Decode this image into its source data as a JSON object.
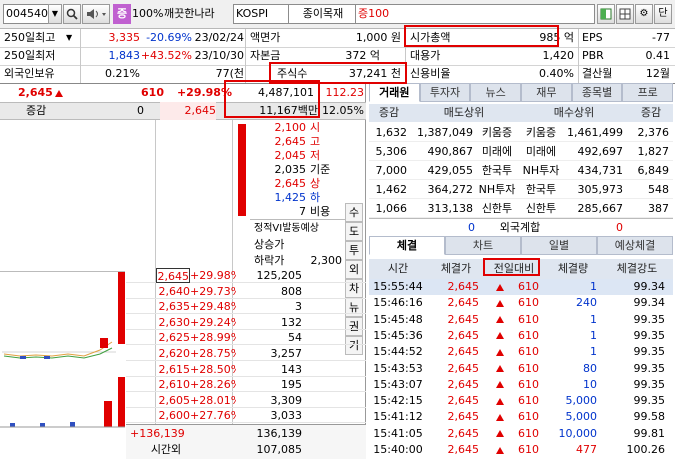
{
  "toolbar": {
    "code": "004540",
    "percent": "100%",
    "stock_name": "깨끗한나라",
    "market": "KOSPI",
    "sector": "종이목재",
    "margin": "증100",
    "tag": "증",
    "right_label": "단"
  },
  "info_rows": [
    {
      "label": "250일최고",
      "v1": "3,335",
      "v2": "-20.69%",
      "v3": "23/02/24",
      "l2": "액면가",
      "v4": "1,000 원",
      "l3": "시가총액",
      "v5": "985 억",
      "l4": "EPS",
      "v6": "-77"
    },
    {
      "label": "250일최저",
      "v1": "1,843",
      "v2": "+43.52%",
      "v3": "23/10/30",
      "l2": "자본금",
      "v4": "372 억",
      "l3": "대용가",
      "v5": "1,420",
      "l4": "PBR",
      "v6": "0.41"
    },
    {
      "label": "외국인보유",
      "v1": "0.21%",
      "v2": "",
      "v3": "77(천",
      "l2": "주식수",
      "v4": "37,241 천",
      "l3": "신용비율",
      "v5": "0.40%",
      "l4": "결산월",
      "v6": "12월"
    }
  ],
  "price_row": {
    "price": "2,645",
    "change": "610",
    "rate": "+29.98%",
    "volume": "4,487,101",
    "prev": "112.23"
  },
  "amount_row": {
    "label": "증감",
    "zero": "0",
    "price": "2,645",
    "amount": "11,167백만",
    "ratio": "12.05%"
  },
  "price_info": [
    {
      "value": "2,100",
      "label": "시"
    },
    {
      "value": "2,645",
      "label": "고"
    },
    {
      "value": "2,045",
      "label": "저"
    },
    {
      "value": "2,035",
      "label": "기준"
    },
    {
      "value": "2,645",
      "label": "상"
    },
    {
      "value": "1,425",
      "label": "하"
    },
    {
      "value": "7",
      "label": "비용"
    }
  ],
  "vi": {
    "title": "정적VI발동예상",
    "up_label": "상승가",
    "down_label": "하락가",
    "down_value": "2,300"
  },
  "side_buttons": [
    "수",
    "도",
    "투",
    "외",
    "차",
    "뉴",
    "권",
    "기"
  ],
  "asks": [],
  "bids": [
    {
      "price": "2,645",
      "rate": "+29.98%",
      "qty": "125,205"
    },
    {
      "price": "2,640",
      "rate": "+29.73%",
      "qty": "808"
    },
    {
      "price": "2,635",
      "rate": "+29.48%",
      "qty": "3"
    },
    {
      "price": "2,630",
      "rate": "+29.24%",
      "qty": "132"
    },
    {
      "price": "2,625",
      "rate": "+28.99%",
      "qty": "54"
    },
    {
      "price": "2,620",
      "rate": "+28.75%",
      "qty": "3,257"
    },
    {
      "price": "2,615",
      "rate": "+28.50%",
      "qty": "143"
    },
    {
      "price": "2,610",
      "rate": "+28.26%",
      "qty": "195"
    },
    {
      "price": "2,605",
      "rate": "+28.01%",
      "qty": "3,309"
    },
    {
      "price": "2,600",
      "rate": "+27.76%",
      "qty": "3,033"
    }
  ],
  "totals": {
    "diff": "+136,139",
    "bid_total": "136,139",
    "after_label": "시간외",
    "after_value": "107,085"
  },
  "broker_tabs": [
    "거래원",
    "투자자",
    "뉴스",
    "재무",
    "종목별",
    "프로"
  ],
  "broker_header": {
    "delta": "증감",
    "sell": "매도상위",
    "buy": "매수상위",
    "delta2": "증감"
  },
  "brokers": [
    {
      "d1": "1,632",
      "sv": "1,387,049",
      "sn": "키움증",
      "bn": "키움증",
      "bv": "1,461,499",
      "d2": "2,376"
    },
    {
      "d1": "5,306",
      "sv": "490,867",
      "sn": "미래에",
      "bn": "미래에",
      "bv": "492,697",
      "d2": "1,827"
    },
    {
      "d1": "7,000",
      "sv": "429,055",
      "sn": "한국투",
      "bn": "NH투자",
      "bv": "434,731",
      "d2": "6,849"
    },
    {
      "d1": "1,462",
      "sv": "364,272",
      "sn": "NH투자",
      "bn": "한국투",
      "bv": "305,973",
      "d2": "548"
    },
    {
      "d1": "1,066",
      "sv": "313,138",
      "sn": "신한투",
      "bn": "신한투",
      "bv": "285,667",
      "d2": "387"
    }
  ],
  "foreign": {
    "left": "0",
    "label": "외국계합",
    "right": "0"
  },
  "trade_tabs": [
    "체결",
    "차트",
    "일별",
    "예상체결"
  ],
  "trade_header": [
    "시간",
    "체결가",
    "전일대비",
    "체결량",
    "체결강도"
  ],
  "trades": [
    {
      "time": "15:55:44",
      "price": "2,645",
      "chg": "610",
      "qty": "1",
      "str": "99.34",
      "qc": "blue"
    },
    {
      "time": "15:46:16",
      "price": "2,645",
      "chg": "610",
      "qty": "240",
      "str": "99.34",
      "qc": "blue"
    },
    {
      "time": "15:45:48",
      "price": "2,645",
      "chg": "610",
      "qty": "1",
      "str": "99.35",
      "qc": "blue"
    },
    {
      "time": "15:45:36",
      "price": "2,645",
      "chg": "610",
      "qty": "1",
      "str": "99.35",
      "qc": "blue"
    },
    {
      "time": "15:44:52",
      "price": "2,645",
      "chg": "610",
      "qty": "1",
      "str": "99.35",
      "qc": "blue"
    },
    {
      "time": "15:43:53",
      "price": "2,645",
      "chg": "610",
      "qty": "80",
      "str": "99.35",
      "qc": "blue"
    },
    {
      "time": "15:43:07",
      "price": "2,645",
      "chg": "610",
      "qty": "10",
      "str": "99.35",
      "qc": "blue"
    },
    {
      "time": "15:42:15",
      "price": "2,645",
      "chg": "610",
      "qty": "5,000",
      "str": "99.35",
      "qc": "blue"
    },
    {
      "time": "15:41:12",
      "price": "2,645",
      "chg": "610",
      "qty": "5,000",
      "str": "99.58",
      "qc": "blue"
    },
    {
      "time": "15:41:05",
      "price": "2,645",
      "chg": "610",
      "qty": "10,000",
      "str": "99.81",
      "qc": "blue"
    },
    {
      "time": "15:40:00",
      "price": "2,645",
      "chg": "610",
      "qty": "477",
      "str": "100.26",
      "qc": "red"
    }
  ],
  "colors": {
    "up": "#e00000",
    "down": "#0033cc",
    "highlight": "#e00000",
    "header": "#dfe6f0"
  }
}
